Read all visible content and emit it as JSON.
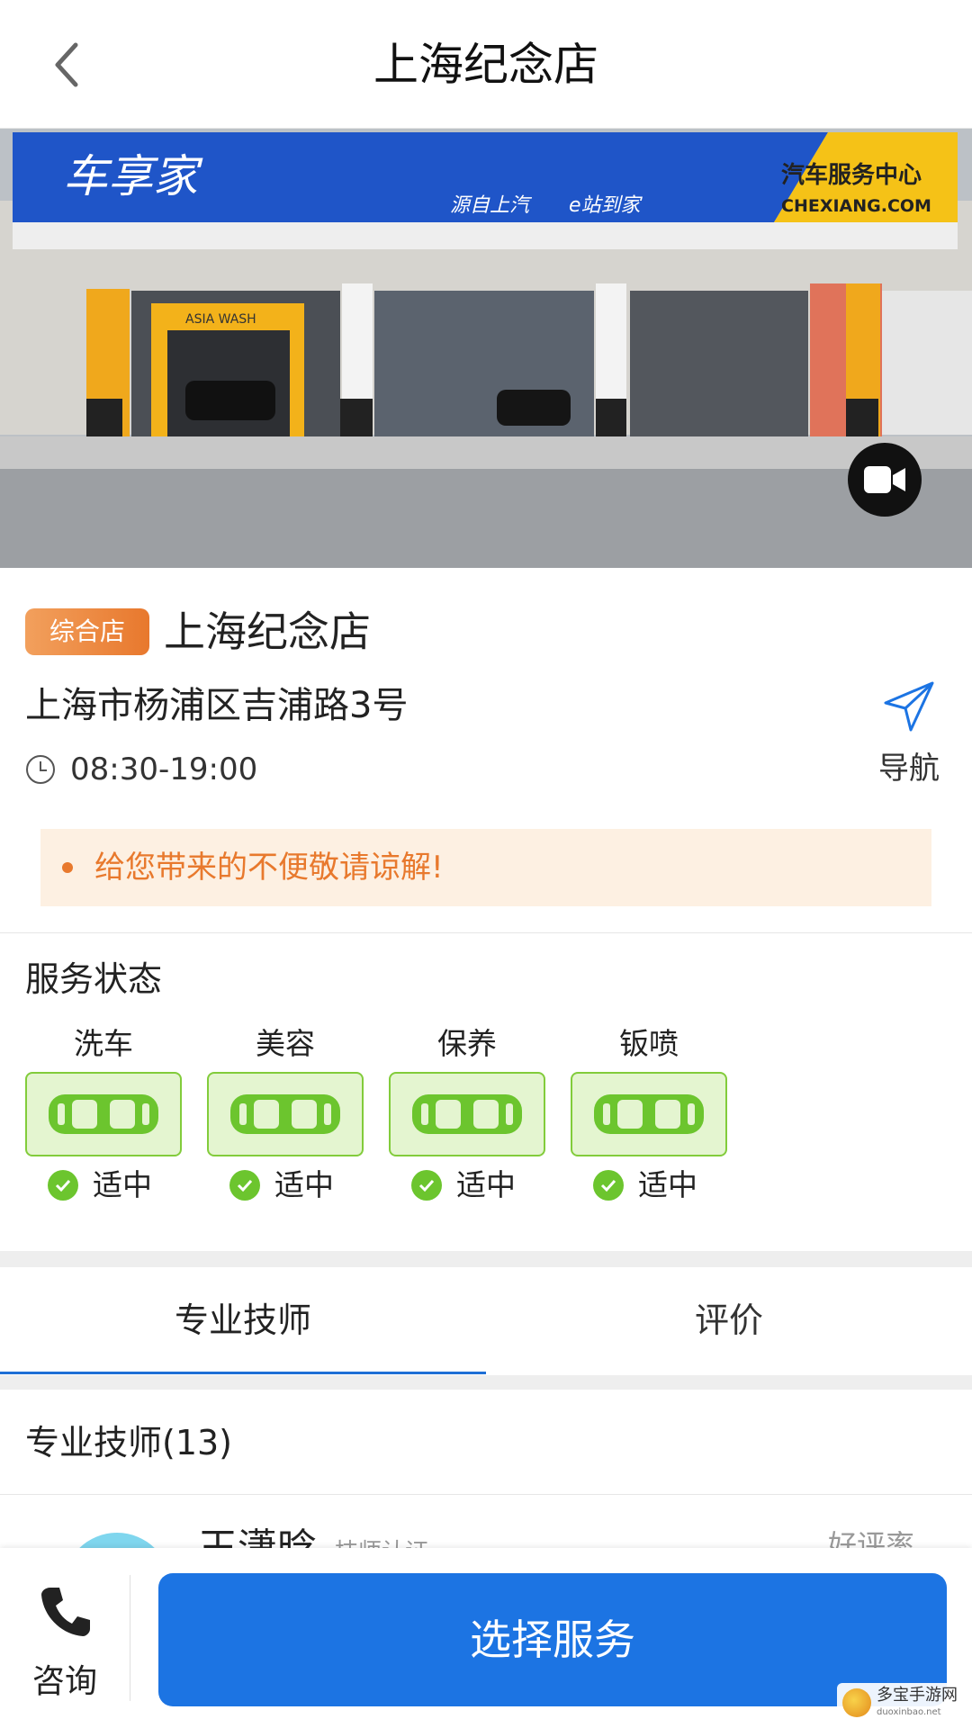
{
  "header": {
    "title": "上海纪念店"
  },
  "hero": {
    "sign_brand": "车享家",
    "sign_slogan1": "源自上汽",
    "sign_slogan2": "e站到家",
    "sign_right_cn": "汽车服务中心",
    "sign_right_en": "CHEXIANG.COM",
    "car_wash_label": "ASIA WASH"
  },
  "store": {
    "badge": "综合店",
    "name": "上海纪念店",
    "address": "上海市杨浦区吉浦路3号",
    "hours": "08:30-19:00",
    "nav_label": "导航",
    "notice": "给您带来的不便敬请谅解!"
  },
  "service_status": {
    "title": "服务状态",
    "items": [
      {
        "label": "洗车",
        "state": "适中"
      },
      {
        "label": "美容",
        "state": "适中"
      },
      {
        "label": "保养",
        "state": "适中"
      },
      {
        "label": "钣喷",
        "state": "适中"
      }
    ]
  },
  "tabs": [
    {
      "label": "专业技师",
      "active": true
    },
    {
      "label": "评价",
      "active": false
    }
  ],
  "technicians": {
    "title": "专业技师(13)",
    "first_name": "王潇晗",
    "first_sub": "技师认证",
    "first_rate_label": "好评率"
  },
  "bottom_bar": {
    "consult_label": "咨询",
    "select_label": "选择服务"
  },
  "watermark": {
    "text": "多宝手游网",
    "sub": "duoxinbao.net"
  },
  "colors": {
    "primary": "#1c74e3",
    "accent": "#e8792d",
    "ok": "#6cc52e"
  }
}
